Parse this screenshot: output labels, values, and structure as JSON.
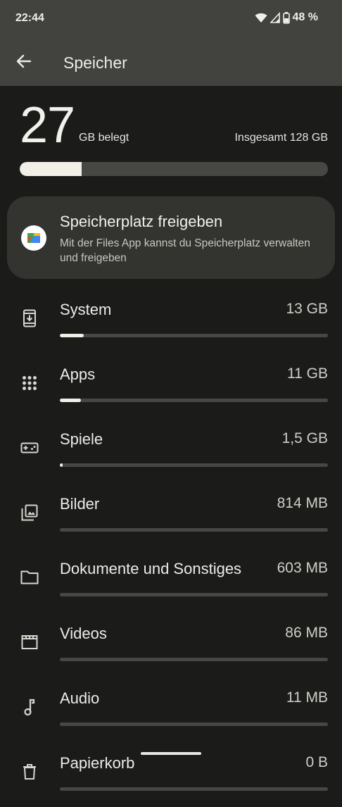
{
  "status": {
    "time": "22:44",
    "battery": "48 %"
  },
  "appbar": {
    "title": "Speicher"
  },
  "summary": {
    "used_number": "27",
    "used_unit": "GB belegt",
    "total_label": "Insgesamt 128 GB",
    "used_fraction": 0.2
  },
  "card": {
    "title": "Speicherplatz freigeben",
    "description": "Mit der Files App kannst du Speicherplatz verwalten und freigeben",
    "icon": "files-app-icon"
  },
  "categories": [
    {
      "label": "System",
      "value": "13 GB",
      "fraction": 0.09,
      "icon": "system-update-icon"
    },
    {
      "label": "Apps",
      "value": "11 GB",
      "fraction": 0.08,
      "icon": "apps-grid-icon"
    },
    {
      "label": "Spiele",
      "value": "1,5 GB",
      "fraction": 0.01,
      "icon": "gamepad-icon"
    },
    {
      "label": "Bilder",
      "value": "814 MB",
      "fraction": 0.0,
      "icon": "photo-library-icon"
    },
    {
      "label": "Dokumente und Sonstiges",
      "value": "603 MB",
      "fraction": 0.0,
      "icon": "folder-icon"
    },
    {
      "label": "Videos",
      "value": "86 MB",
      "fraction": 0.0,
      "icon": "movie-icon"
    },
    {
      "label": "Audio",
      "value": "11 MB",
      "fraction": 0.0,
      "icon": "music-note-icon"
    },
    {
      "label": "Papierkorb",
      "value": "0 B",
      "fraction": 0.0,
      "icon": "trash-icon"
    }
  ],
  "colors": {
    "background": "#1b1c1a",
    "appbar": "#42433f",
    "card": "#33342f",
    "bar_track": "#474844",
    "bar_fill": "#f1efe6"
  }
}
